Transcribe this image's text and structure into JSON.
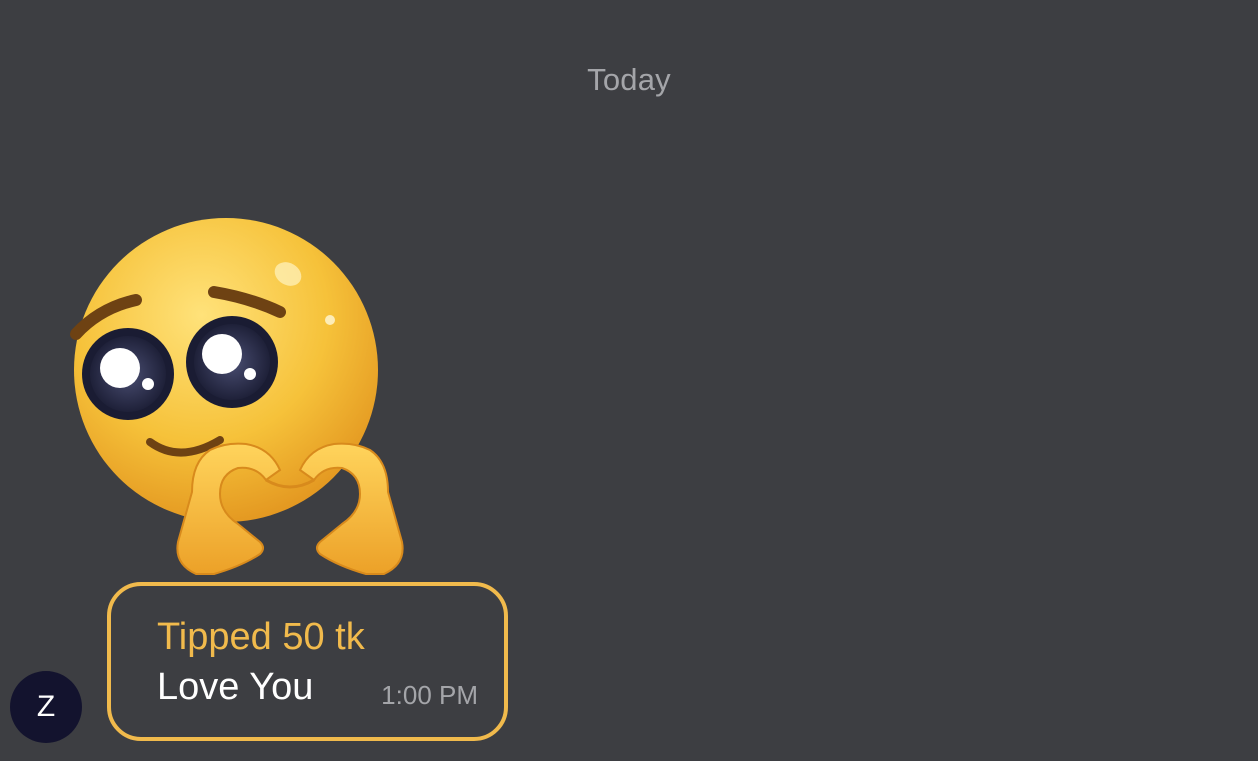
{
  "chat": {
    "date_separator": "Today",
    "message": {
      "sender_initial": "Z",
      "sticker": "pleading-face-heart-hands-emoji",
      "tip_amount": "Tipped 50 tk",
      "text": "Love You",
      "time": "1:00 PM"
    }
  },
  "colors": {
    "background": "#3d3e42",
    "accent_gold": "#f1ba4c",
    "muted_text": "#a4a5a9",
    "avatar_bg": "#13132e",
    "text": "#ffffff"
  }
}
